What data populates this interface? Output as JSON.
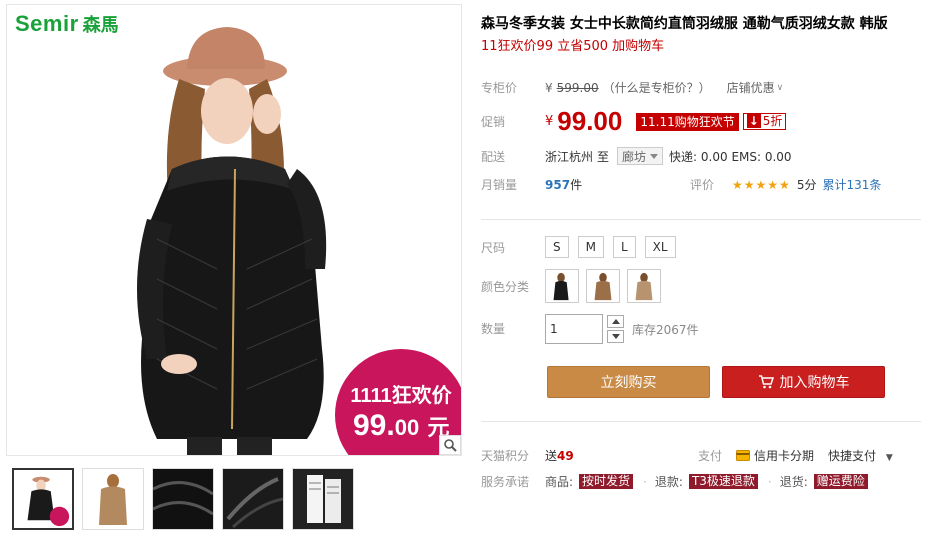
{
  "brand": {
    "latin": "Semir",
    "cjk": "森馬"
  },
  "promo_badge": {
    "line1": "1111狂欢价",
    "price_main": "99.",
    "price_dec": "00",
    "unit": "元"
  },
  "product": {
    "title": "森马冬季女装 女士中长款简约直筒羽绒服 通勒气质羽绒女款 韩版",
    "subtitle": "11狂欢价99 立省500 加购物车"
  },
  "price": {
    "counter_label": "专柜价",
    "currency": "¥",
    "counter_value": "599.00",
    "counter_help": "（什么是专柜价？）",
    "store_discount": "店铺优惠",
    "promo_label": "促销",
    "promo_value": "99.00",
    "promo_tag": "11.11购物狂欢节",
    "discount_arrow": "↓",
    "discount_text": "5折"
  },
  "shipping": {
    "label": "配送",
    "from": "浙江杭州",
    "to_word": "至",
    "to": "廊坊",
    "fees": "快递: 0.00 EMS: 0.00"
  },
  "sales": {
    "label": "月销量",
    "count": "957",
    "unit": "件",
    "review_label": "评价",
    "stars": "★★★★★",
    "score": "5分",
    "total_reviews": "累计131条"
  },
  "options": {
    "size_label": "尺码",
    "sizes": [
      "S",
      "M",
      "L",
      "XL"
    ],
    "color_label": "颜色分类",
    "quantity_label": "数量",
    "quantity": "1",
    "stock": "库存2067件"
  },
  "actions": {
    "buy_now": "立刻购买",
    "add_cart": "加入购物车"
  },
  "extras": {
    "points_label": "天猫积分",
    "points_prefix": "送",
    "points_value": "49",
    "pay_label": "支付",
    "pay_credit": "信用卡分期",
    "pay_quick": "快捷支付",
    "service_label": "服务承诺",
    "service_goods": "商品:",
    "service_goods_tag": "按时发货",
    "service_refund": "退款:",
    "service_refund_tag": "T3极速退款",
    "service_return": "退货:",
    "service_return_tag": "赠运费险"
  },
  "colors": {
    "accent": "#c40000",
    "buy": "#c98a45",
    "cart": "#c91f1f",
    "brand": "#1aa23a",
    "badge": "#c8155b"
  }
}
